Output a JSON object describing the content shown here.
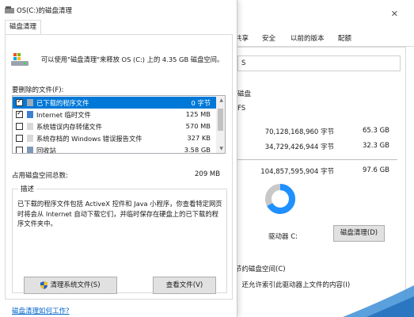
{
  "props": {
    "close_glyph": "✕",
    "tabs": [
      "共享",
      "安全",
      "以前的版本",
      "配额"
    ],
    "name_value": "S",
    "label_drive": "磁盘",
    "label_fs": "FS",
    "used_bytes": "70,128,168,960 字节",
    "used_gb": "65.3 GB",
    "free_bytes": "34,729,426,944 字节",
    "free_gb": "32.3 GB",
    "capacity_bytes": "104,857,595,904 字节",
    "capacity_gb": "97.6 GB",
    "drive_label": "驱动器 C:",
    "cleanup_button": "磁盘清理(D)",
    "compress_text": "节约磁盘空间(C)",
    "index_text": "，还允许索引此驱动器上文件的内容(I)",
    "used_fraction": 0.67,
    "colors": {
      "used": "#1e90ff",
      "free": "#c8c8c8"
    }
  },
  "dialog": {
    "title": "OS(C:)的磁盘清理",
    "tab": "磁盘清理",
    "intro": "可以使用\"磁盘清理\"来释放 OS (C:) 上的 4.35 GB 磁盘空间。",
    "files_label": "要删除的文件(F):",
    "files": [
      {
        "name": "已下载的程序文件",
        "size": "0 字节",
        "checked": true,
        "selected": true
      },
      {
        "name": "Internet 临时文件",
        "size": "125 MB",
        "checked": true,
        "selected": false
      },
      {
        "name": "系统错误内存转储文件",
        "size": "570 MB",
        "checked": false,
        "selected": false
      },
      {
        "name": "系统存档的 Windows 错误报告文件",
        "size": "327 KB",
        "checked": false,
        "selected": false
      },
      {
        "name": "回收站",
        "size": "3.58 GB",
        "checked": false,
        "selected": false
      }
    ],
    "total_label": "占用磁盘空间总数:",
    "total_value": "209 MB",
    "desc_title": "描述",
    "desc_text": "已下载的程序文件包括 ActiveX 控件和 Java 小程序，你查看特定网页时将会从 Internet 自动下载它们，并临时保存在硬盘上的已下载的程序文件夹中。",
    "btn_system": "清理系统文件(S)",
    "btn_view": "查看文件(V)",
    "help_link": "磁盘清理如何工作?",
    "accent": "#0078d7"
  }
}
